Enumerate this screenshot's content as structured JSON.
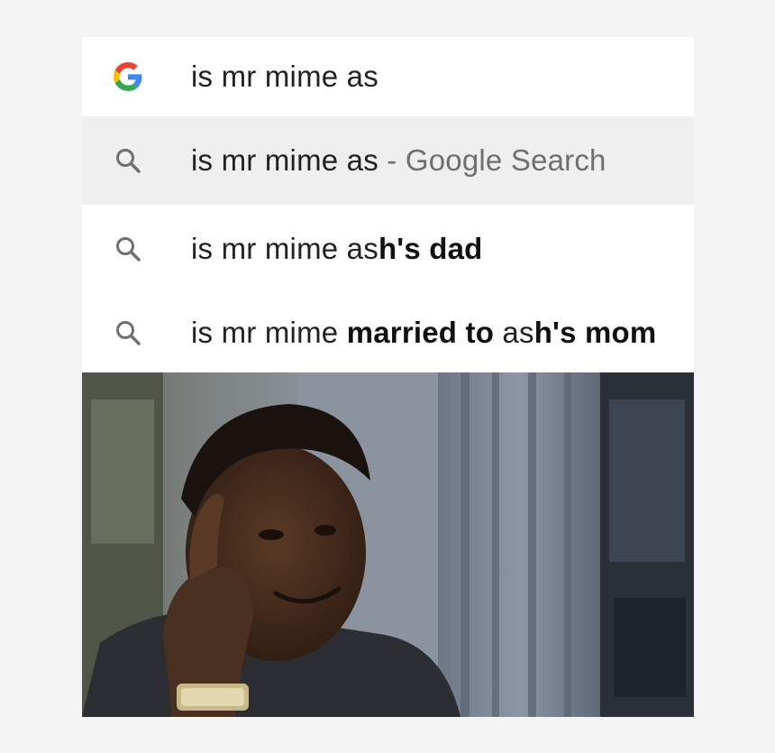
{
  "search": {
    "query": "is mr mime as"
  },
  "suggestions": [
    {
      "plain": "is mr mime as",
      "separator": " - ",
      "suffix": "Google Search"
    },
    {
      "prefix": "is mr mime as",
      "bold": "h's dad"
    },
    {
      "prefix1": "is mr mime ",
      "bold1": "married to",
      "mid": " as",
      "bold2": "h's mom"
    }
  ],
  "icons": {
    "input_icon": "google-g-logo",
    "suggestion_icon": "search-icon"
  },
  "colors": {
    "page_bg": "#f4f4f4",
    "highlight_row": "#efefef",
    "text": "#222222",
    "muted": "#6f6f6f"
  }
}
